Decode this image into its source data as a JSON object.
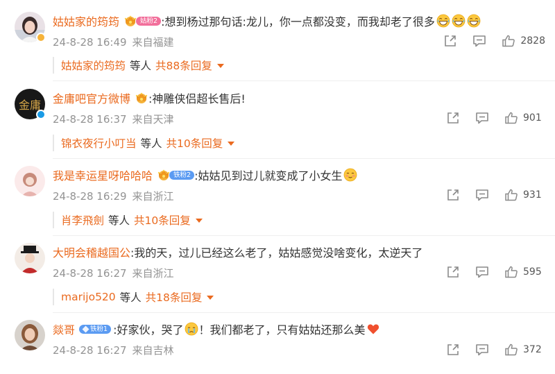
{
  "comments": [
    {
      "username": "姑姑家的筠筠",
      "badge": {
        "type": "fan",
        "label": "姑粉2",
        "color": "pink"
      },
      "text": ":想到杨过那句话:龙儿，你一点都没变，而我却老了很多",
      "emojis": [
        "laugh-cry-emoji",
        "laugh-cry-emoji",
        "laugh-cry-emoji"
      ],
      "time": "24-8-28 16:49",
      "location": "来自福建",
      "likes": "2828",
      "replies": {
        "who": "姑姑家的筠筠",
        "mid": "等人",
        "total": "共88条回复"
      }
    },
    {
      "username": "金庸吧官方微博",
      "badge": {
        "type": "crown-only"
      },
      "verified": true,
      "text": ":神雕侠侣超长售后!",
      "time": "24-8-28 16:37",
      "location": "来自天津",
      "likes": "901",
      "replies": {
        "who": "锦衣夜行小叮当",
        "mid": "等人",
        "total": "共10条回复"
      }
    },
    {
      "username": "我是幸运星呀哈哈哈",
      "badge": {
        "type": "fan",
        "label": "铁粉2",
        "color": "blue"
      },
      "text": ":姑姑见到过儿就变成了小女生",
      "emojis": [
        "blush-emoji"
      ],
      "time": "24-8-28 16:29",
      "location": "来自浙江",
      "likes": "931",
      "replies": {
        "who": "肖李飛劍",
        "mid": "等人",
        "total": "共10条回复"
      }
    },
    {
      "username": "大明会稽越国公",
      "text": ":我的天，过儿已经这么老了，姑姑感觉没啥变化，太逆天了",
      "time": "24-8-28 16:27",
      "location": "来自浙江",
      "likes": "595",
      "replies": {
        "who": "marijo520",
        "mid": "等人",
        "total": "共18条回复"
      }
    },
    {
      "username": "燚哥",
      "badge": {
        "type": "pill-only",
        "label": "铁粉1",
        "color": "blue"
      },
      "text_before": ":好家伙，哭了",
      "text_after": "！我们都老了，只有姑姑还那么美",
      "emojis": [
        "cry-emoji",
        "heart-emoji"
      ],
      "time": "24-8-28 16:27",
      "location": "来自吉林",
      "likes": "372"
    }
  ],
  "colors": {
    "username": "#ea6a1f",
    "meta": "#939393",
    "fan_pink": "#f26f9b",
    "fan_blue": "#5b9bf2",
    "verified": "#1a9be6"
  },
  "icons": [
    "share-icon",
    "comment-icon",
    "like-icon",
    "chevron-down-icon"
  ]
}
